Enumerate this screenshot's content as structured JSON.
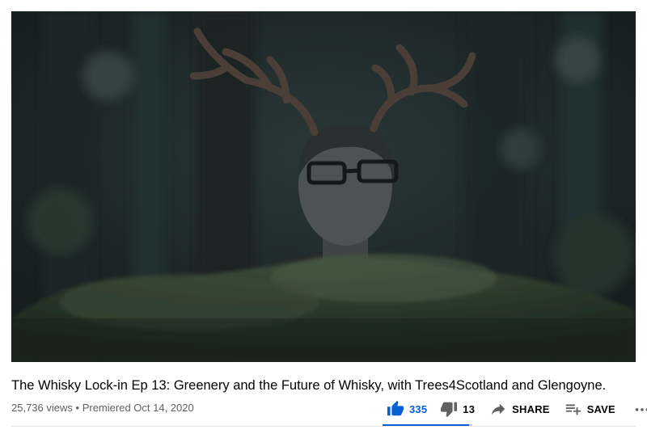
{
  "video": {
    "title": "The Whisky Lock-in Ep 13: Greenery and the Future of Whisky, with Trees4Scotland and Glengoyne.",
    "views": "25,736 views",
    "separator": "•",
    "premiered": "Premiered Oct 14, 2020"
  },
  "actions": {
    "like_count": "335",
    "dislike_count": "13",
    "share_label": "SHARE",
    "save_label": "SAVE",
    "like_ratio": 0.963
  },
  "icons": {
    "like": "thumbs-up-icon",
    "dislike": "thumbs-down-icon",
    "share": "share-arrow-icon",
    "save": "playlist-add-icon",
    "more": "more-horiz-icon"
  },
  "colors": {
    "accent": "#065fd4",
    "text": "#030303",
    "secondary_text": "#606060"
  }
}
